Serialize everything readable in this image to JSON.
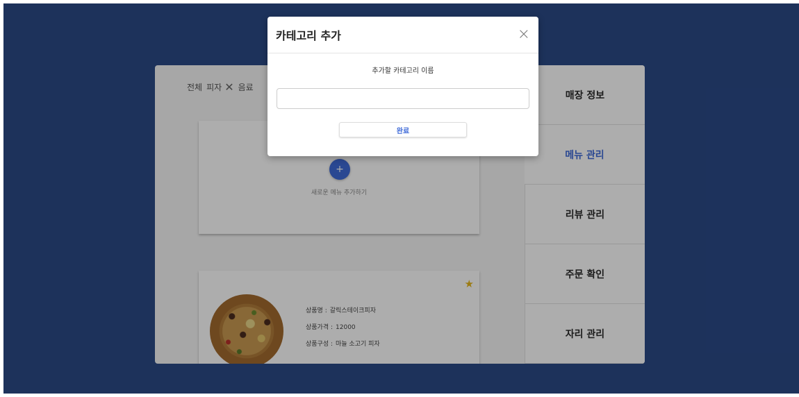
{
  "categories": [
    {
      "label": "전체"
    },
    {
      "label": "피자"
    },
    {
      "label": "음료"
    }
  ],
  "add_menu": {
    "plus": "+",
    "label": "새로운 메뉴 추가하기"
  },
  "menu_item": {
    "name_label": "상품명 :",
    "name": "갈릭스테이크피자",
    "price_label": "상품가격 :",
    "price": "12000",
    "desc_label": "상품구성 :",
    "desc": "마늘 소고기 피자",
    "favorite": true
  },
  "sidebar": {
    "items": [
      {
        "label": "매장 정보",
        "active": false
      },
      {
        "label": "메뉴 관리",
        "active": true
      },
      {
        "label": "리뷰 관리",
        "active": false
      },
      {
        "label": "주문 확인",
        "active": false
      },
      {
        "label": "자리 관리",
        "active": false
      }
    ]
  },
  "modal": {
    "title": "카테고리 추가",
    "close": "×",
    "field_label": "추가할 카테고리 이름",
    "input_value": "",
    "placeholder": "",
    "submit_label": "완료"
  },
  "colors": {
    "background": "#2b4a87",
    "accent": "#3f6ad8",
    "star": "#e5b51b"
  },
  "icons": {
    "close": "close-icon",
    "remove_category": "x-icon",
    "add": "plus-icon",
    "favorite": "star-icon"
  }
}
